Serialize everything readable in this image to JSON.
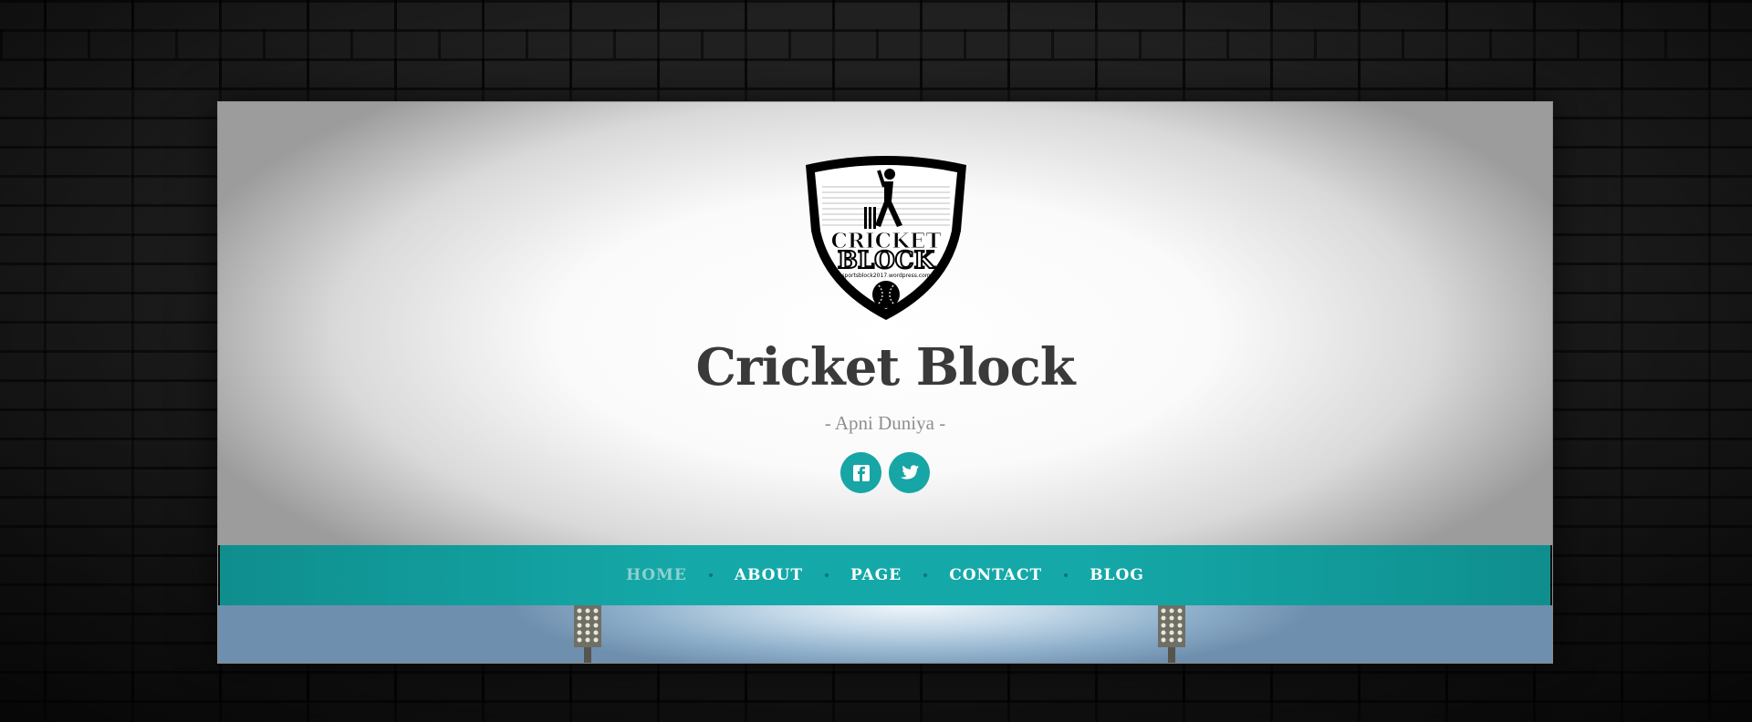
{
  "site": {
    "title": "Cricket Block",
    "tagline": "- Apni Duniya -",
    "logo": {
      "line1": "CRICKET",
      "line2": "BLOCK",
      "url_text": "sportsblock2017.wordpress.com"
    }
  },
  "social": [
    {
      "name": "facebook",
      "icon": "facebook-icon"
    },
    {
      "name": "twitter",
      "icon": "twitter-icon"
    }
  ],
  "nav": {
    "items": [
      {
        "label": "HOME",
        "active": true
      },
      {
        "label": "ABOUT",
        "active": false
      },
      {
        "label": "PAGE",
        "active": false
      },
      {
        "label": "CONTACT",
        "active": false
      },
      {
        "label": "BLOG",
        "active": false
      }
    ]
  },
  "colors": {
    "accent": "#18a5a5",
    "nav_active": "#8fd0d0",
    "title": "#3a3a3a",
    "tagline": "#8f8f8f"
  }
}
